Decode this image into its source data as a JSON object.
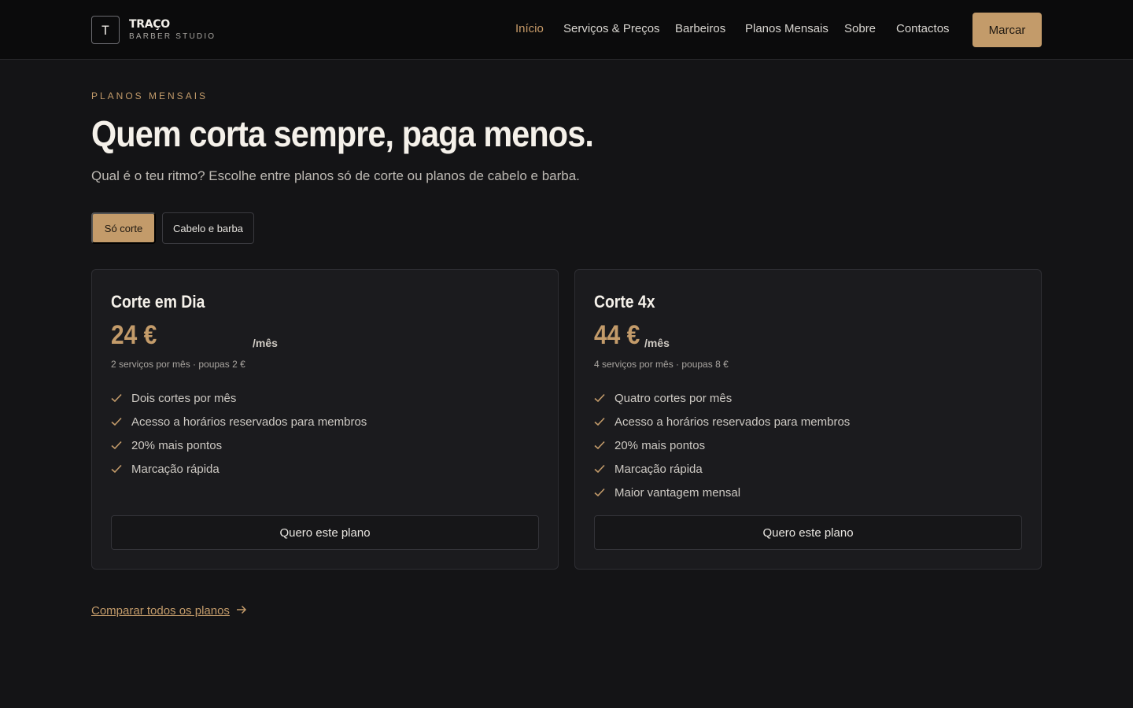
{
  "brand": {
    "logo_letter": "T",
    "name": "TRAÇO",
    "tagline": "BARBER STUDIO"
  },
  "nav": {
    "items": [
      {
        "label": "Início",
        "active": true
      },
      {
        "label": "Serviços & Preços",
        "active": false
      },
      {
        "label": "Barbeiros",
        "active": false
      },
      {
        "label": "Planos Mensais",
        "active": false
      },
      {
        "label": "Sobre",
        "active": false
      },
      {
        "label": "Contactos",
        "active": false
      }
    ],
    "cta_label": "Marcar"
  },
  "hero": {
    "eyebrow": "PLANOS MENSAIS",
    "title": "Quem corta sempre, paga menos.",
    "subtitle": "Qual é o teu ritmo? Escolhe entre planos só de corte ou planos de cabelo e barba."
  },
  "filters": {
    "options": [
      {
        "label": "Só corte",
        "selected": true
      },
      {
        "label": "Cabelo e barba",
        "selected": false
      }
    ]
  },
  "plans": [
    {
      "name": "Corte em Dia",
      "price": "24 €",
      "period": "/mês",
      "meta": "2 serviços por mês · poupas 2 €",
      "features": [
        "Dois cortes por mês",
        "Acesso a horários reservados para membros",
        "20% mais pontos",
        "Marcação rápida"
      ],
      "button_label": "Quero este plano"
    },
    {
      "name": "Corte 4x",
      "price": "44 €",
      "period": "/mês",
      "meta": "4 serviços por mês · poupas 8 €",
      "features": [
        "Quatro cortes por mês",
        "Acesso a horários reservados para membros",
        "20% mais pontos",
        "Marcação rápida",
        "Maior vantagem mensal"
      ],
      "button_label": "Quero este plano"
    }
  ],
  "compare_link": {
    "label": "Comparar todos os planos",
    "icon": "arrow-right-icon"
  },
  "colors": {
    "accent": "#c39b6a",
    "background": "#141416",
    "header": "#0b0b0c",
    "card": "#1b1b1e"
  }
}
